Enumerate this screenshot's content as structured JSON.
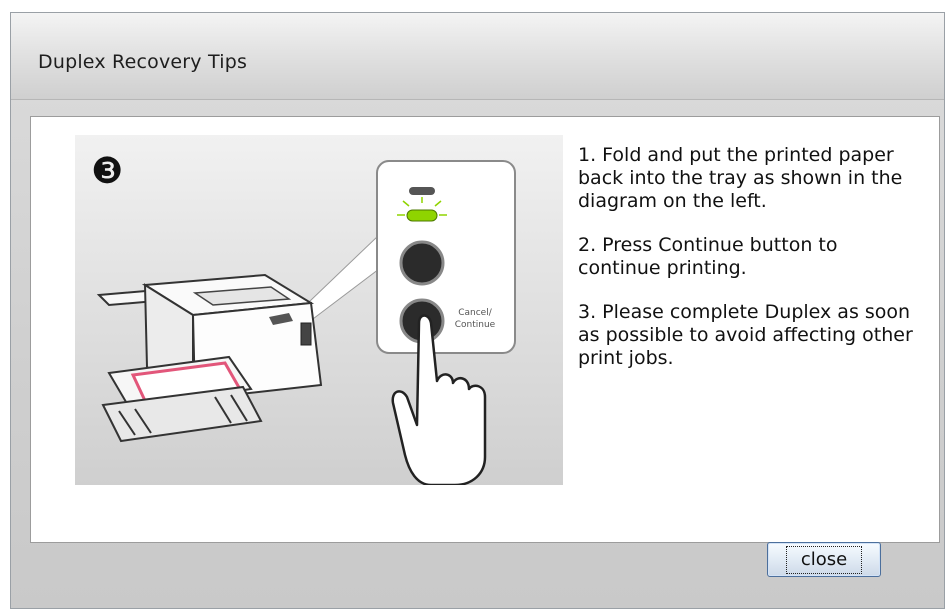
{
  "window": {
    "title": "Duplex Recovery Tips"
  },
  "illustration": {
    "step_number": "❸",
    "button_label_line1": "Cancel/",
    "button_label_line2": "Continue",
    "led_color": "#8fd400"
  },
  "instructions": [
    "1. Fold and put the printed paper back into the tray as shown in the diagram on the left.",
    "2. Press Continue button to continue printing.",
    "3. Please complete Duplex as soon as possible to avoid affecting other print jobs."
  ],
  "footer": {
    "close_label": "close"
  }
}
